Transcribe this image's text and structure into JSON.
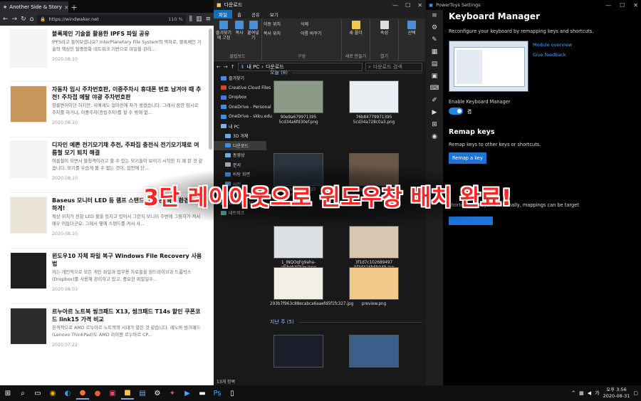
{
  "browser": {
    "tab_title": "Another Side & Story",
    "url": "https://windwaker.net",
    "url_domain": "windwaker.net",
    "zoom": "110 %",
    "articles": [
      {
        "title": "블록체인 기술을 활용한 IPFS 파일 공유",
        "excerpt": "IPFS라고 들어보셨나요? InterPlanetary File System의 약자로, 블록체인 기술의 핵심인 탈중앙화 네트워크 기반으로 파일을 관리...",
        "date": "2020.08.10"
      },
      {
        "title": "자동차 임시 주차번호판, 이중주차시 휴대폰 번호 남겨야 때 추천! 주차접 메탈 야광 주차번호판",
        "excerpt": "장롱면허이던 하지만, 저에게도 얼마전에 차가 생겼습니다. 그래서 잠깐 임시로 주차를 하거나, 이중주차(종립주차)를 할 수 밖에 없...",
        "date": "2020.08.10"
      },
      {
        "title": "디자인 예쁜 전기모기채 추천, 주파집 충전식 전기모기채로 여름철 모기 퇴치 해결",
        "excerpt": "여름철이 되면서 불청객이라고 할 수 있는 모기들이 보이기 시작한 지 꽤 된 것 같습니다. 모기를 우습게 볼 수 없는 것이, 집안에 단...",
        "date": "2020.08.10"
      },
      {
        "title": "Baseus 모니터 LED 등 램프 스탠드, 어두운 책상 환경을 환하게!",
        "excerpt": "책상 위치가 전창 LED 불을 등지고 있어서 그런지 모니터 주변에 그림자가 져서 매우 어둡더군요. 그래서 옆에 스탠드를 켜서 사...",
        "date": "2020.08.10"
      },
      {
        "title": "윈도우10 자체 파일 복구 Windows File Recovery 사용법",
        "excerpt": "저는 개인적으로 모든 개인 파일과 업무용 자료들을 원드라이브과 드롭박스(Dropbox)를 사용해 관리하고 있고, 중요한 파일일수...",
        "date": "2020.08.03"
      },
      {
        "title": "르누아르 노트북 씽크패드 X13, 씽크패드 T14s 할인 쿠폰코드 link15 가격 비교",
        "excerpt": "본격적으로 AMD 르누아르 노트북의 시대가 열린 것 같습니다. 레노버 씽크패드 (Lenovo ThinkPad)도 AMD 라이젠 르누아르 CP...",
        "date": "2020.07.22"
      }
    ]
  },
  "explorer": {
    "title": "다운로드",
    "tabs": [
      "파일",
      "홈",
      "공유",
      "보기"
    ],
    "ribbon": {
      "pin": "즐겨찾기에 고정",
      "copy": "복사",
      "paste": "붙여넣기",
      "move_to": "이동 위치",
      "copy_to": "복사 위치",
      "delete": "삭제",
      "rename": "이름 바꾸기",
      "new_folder": "새 폴더",
      "properties": "속성",
      "select": "선택",
      "clipboard": "클립보드",
      "organize": "구성",
      "new": "새로 만들기",
      "open": "열기"
    },
    "address": [
      "내 PC",
      "다운로드"
    ],
    "search_placeholder": "다운로드 검색",
    "nav": [
      {
        "label": "즐겨찾기",
        "color": "#3b8eea"
      },
      {
        "label": "Creative Cloud Files",
        "color": "#d8442b"
      },
      {
        "label": "Dropbox",
        "color": "#3b7ce6"
      },
      {
        "label": "OneDrive - Personal",
        "color": "#3b8eea"
      },
      {
        "label": "OneDrive - skku.edu",
        "color": "#3b8eea"
      },
      {
        "label": "내 PC",
        "color": "#7cb2e8"
      },
      {
        "label": "3D 개체",
        "color": "#5fb0e8"
      },
      {
        "label": "다운로드",
        "color": "#3b8eea"
      },
      {
        "label": "동영상",
        "color": "#5fb0e8"
      },
      {
        "label": "문서",
        "color": "#9ab"
      },
      {
        "label": "바탕 화면",
        "color": "#3b8eea"
      },
      {
        "label": "사진",
        "color": "#5fb0e8"
      },
      {
        "label": "음악",
        "color": "#5fb0e8"
      },
      {
        "label": "Windows (C:)",
        "color": "#888"
      },
      {
        "label": "네트워크",
        "color": "#6aa"
      }
    ],
    "groups": {
      "today": "오늘 (8)",
      "lastweek": "지난 주 (5)"
    },
    "files": [
      {
        "name": "90e9a679971395 5cd34a6fd30ef.png",
        "color": "#8a9a84"
      },
      {
        "name": "76b84779971395 5cd34a728c0a3.png",
        "color": "#e8eef2"
      },
      {
        "name": "5853df96992727 5ebb001a...",
        "color": "#2a3540"
      },
      {
        "name": "0_PEqgRZ8qv53Jwb.jpg",
        "color": "#6b5a4a"
      },
      {
        "name": "1_INQOqFg9aha-aEibqhXQUw.jpeg",
        "color": "#dcdfe3"
      },
      {
        "name": "3f1d7c102689497 5f3d416b5b049.jpg",
        "color": "#d8c6b0"
      },
      {
        "name": "293b7f963c88ecabca6aaefd5f1fc327.jpg",
        "color": "#f4efe4"
      },
      {
        "name": "preview.png",
        "color": "#f3c98a"
      },
      {
        "name": "",
        "color": "#1a1e2a"
      },
      {
        "name": "",
        "color": "#3a5f8a"
      }
    ],
    "status": "13개 항목"
  },
  "powertoys": {
    "window_title": "PowerToys Settings",
    "heading": "Keyboard Manager",
    "description": "Reconfigure your keyboard by remapping keys and shortcuts.",
    "link_overview": "Module overview",
    "link_feedback": "Give feedback",
    "enable_label": "Enable Keyboard Manager",
    "toggle_state": "켬",
    "remap_heading": "Remap keys",
    "remap_desc": "Remap keys to other keys or shortcuts.",
    "remap_button": "Remap a key",
    "partial_text": "shortcuts or keys. Additionally, mappings can be target"
  },
  "caption": "3단 레이아웃으로 윈도우창 배치 완료!",
  "taskbar": {
    "time": "오후 3:56",
    "date": "2020-08-31"
  }
}
